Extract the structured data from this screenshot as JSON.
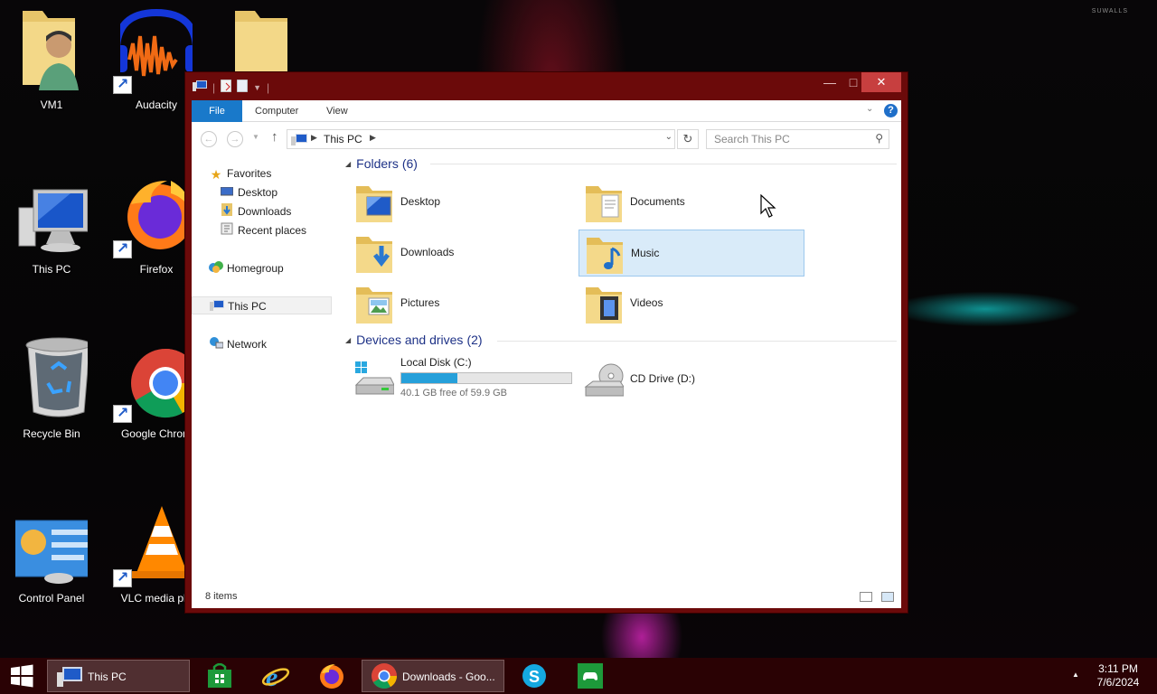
{
  "watermark": "SUWALLS",
  "desktop": {
    "icons": [
      {
        "label": "VM1",
        "icon": "user-folder-icon",
        "shortcut": false
      },
      {
        "label": "Audacity",
        "icon": "audacity-icon",
        "shortcut": true
      },
      {
        "label": "This PC",
        "icon": "computer-icon",
        "shortcut": false
      },
      {
        "label": "Firefox",
        "icon": "firefox-icon",
        "shortcut": true
      },
      {
        "label": "Recycle Bin",
        "icon": "recycle-bin-icon",
        "shortcut": false
      },
      {
        "label": "Google Chrom",
        "icon": "chrome-icon",
        "shortcut": true
      },
      {
        "label": "Control Panel",
        "icon": "control-panel-icon",
        "shortcut": false
      },
      {
        "label": "VLC media pla",
        "icon": "vlc-icon",
        "shortcut": true
      }
    ]
  },
  "window": {
    "title": "This PC",
    "controls": {
      "minimize": "—",
      "maximize": "□",
      "close": "✕"
    },
    "ribbon_tabs": [
      "File",
      "Computer",
      "View"
    ],
    "help": "?",
    "address": {
      "crumb": "This PC"
    },
    "search": {
      "placeholder": "Search This PC"
    },
    "nav_pane": {
      "favorites": "Favorites",
      "favorites_items": [
        "Desktop",
        "Downloads",
        "Recent places"
      ],
      "homegroup": "Homegroup",
      "this_pc": "This PC",
      "network": "Network"
    },
    "folders_group": {
      "title": "Folders",
      "count": "(6)"
    },
    "folders": [
      {
        "name": "Desktop",
        "overlay": "monitor"
      },
      {
        "name": "Documents",
        "overlay": "document"
      },
      {
        "name": "Downloads",
        "overlay": "download-arrow"
      },
      {
        "name": "Music",
        "overlay": "music-note",
        "selected": true
      },
      {
        "name": "Pictures",
        "overlay": "picture"
      },
      {
        "name": "Videos",
        "overlay": "film"
      }
    ],
    "drives_group": {
      "title": "Devices and drives",
      "count": "(2)"
    },
    "drives": [
      {
        "name": "Local Disk (C:)",
        "free": "40.1 GB free of 59.9 GB",
        "used_fraction": 0.33,
        "bar_color": "#26a0da"
      },
      {
        "name": "CD Drive (D:)"
      }
    ],
    "status": {
      "items": "8 items"
    }
  },
  "taskbar": {
    "buttons": [
      {
        "label": "This PC",
        "icon": "explorer-icon"
      },
      {
        "label": "",
        "icon": "store-icon"
      },
      {
        "label": "",
        "icon": "internet-explorer-icon"
      },
      {
        "label": "",
        "icon": "firefox-icon"
      },
      {
        "label": "Downloads - Goo...",
        "icon": "chrome-icon"
      },
      {
        "label": "",
        "icon": "skype-icon"
      },
      {
        "label": "",
        "icon": "xbox-icon"
      }
    ],
    "clock": {
      "time": "3:11 PM",
      "date": "7/6/2024"
    }
  },
  "colors": {
    "accent": "#1979ca",
    "window_frame": "#6b0a0a",
    "close": "#c73f3f",
    "selection": "#d9ebf9"
  }
}
